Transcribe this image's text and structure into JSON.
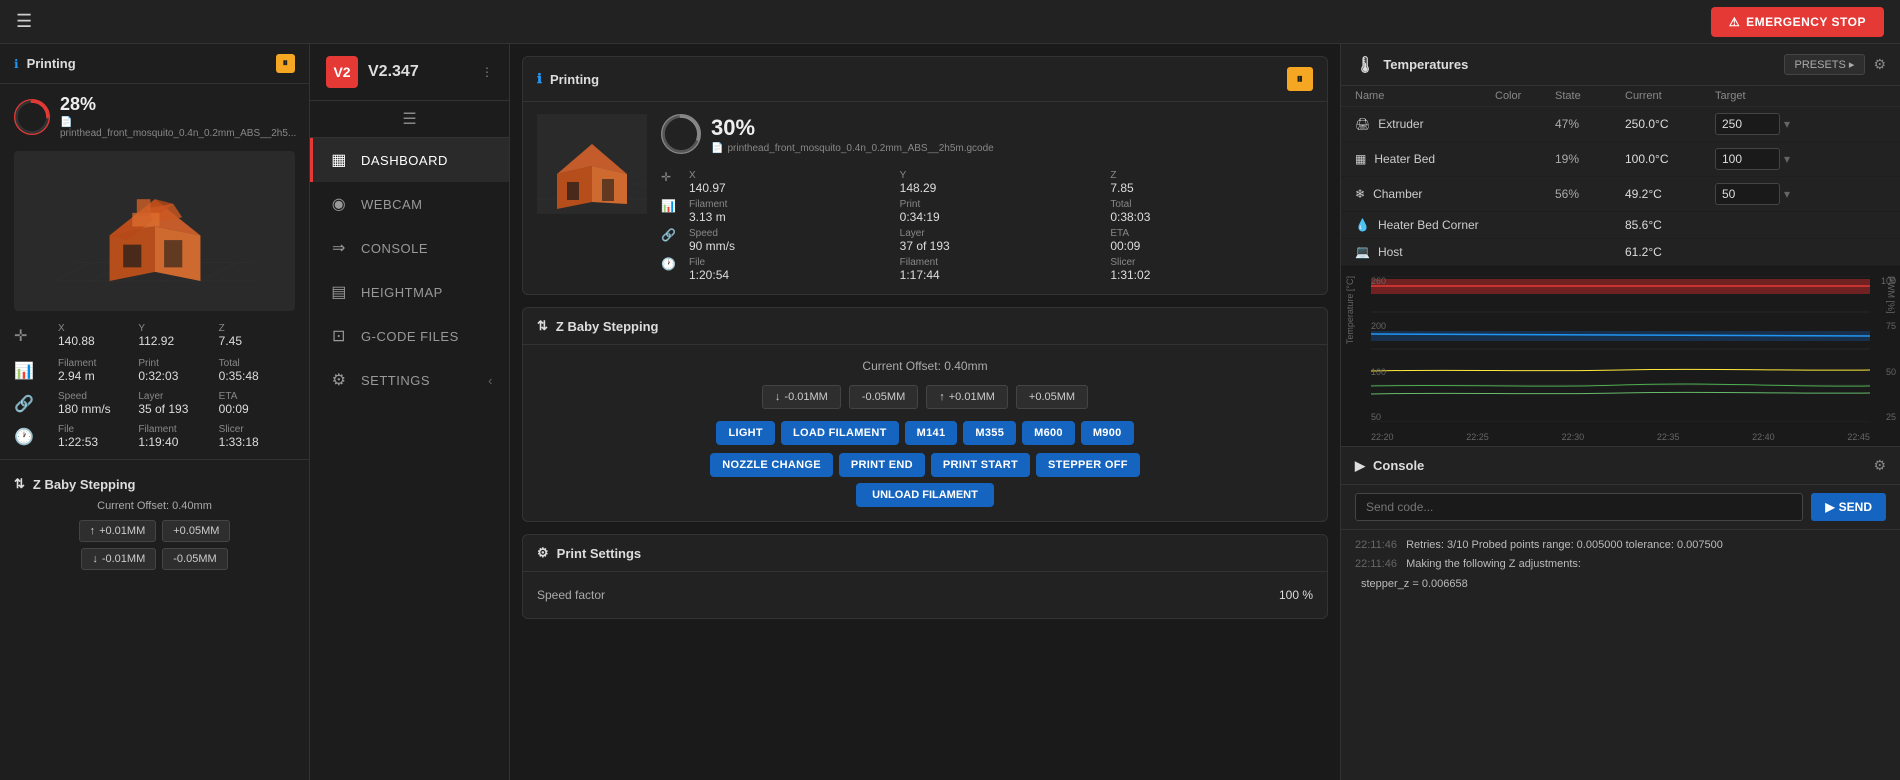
{
  "topbar": {
    "emergency_label": "EMERGENCY STOP",
    "hamburger_icon": "☰"
  },
  "left_panel": {
    "title": "Printing",
    "pause_label": "⏸",
    "progress_percent": "28%",
    "filename": "printhead_front_mosquito_0.4n_0.2mm_ABS__2h5...",
    "stats": {
      "x_label": "X",
      "x_value": "140.88",
      "y_label": "Y",
      "y_value": "112.92",
      "z_label": "Z",
      "z_value": "7.45",
      "filament_label": "Filament",
      "filament_value": "2.94 m",
      "print_label": "Print",
      "print_value": "0:32:03",
      "total_label": "Total",
      "total_value": "0:35:48",
      "speed_label": "Speed",
      "speed_value": "180 mm/s",
      "layer_label": "Layer",
      "layer_value": "35 of 193",
      "eta_label": "ETA",
      "eta_value": "00:09",
      "file_label": "File",
      "file_value": "1:22:53",
      "filament2_label": "Filament",
      "filament2_value": "1:19:40",
      "slicer_label": "Slicer",
      "slicer_value": "1:33:18"
    },
    "baby_stepping": {
      "title": "Z Baby Stepping",
      "offset_label": "Current Offset: 0.40mm",
      "btn_up_01": "+0.01MM",
      "btn_up_05": "+0.05MM",
      "btn_dn_01": "-0.01MM",
      "btn_dn_05": "-0.05MM"
    }
  },
  "nav": {
    "logo": "V2",
    "version": "V2.347",
    "hamburger": "≡",
    "items": [
      {
        "id": "dashboard",
        "label": "DASHBOARD",
        "icon": "▦",
        "active": true
      },
      {
        "id": "webcam",
        "label": "WEBCAM",
        "icon": "◉"
      },
      {
        "id": "console",
        "label": "CONSOLE",
        "icon": "⇒"
      },
      {
        "id": "heightmap",
        "label": "HEIGHTMAP",
        "icon": "▤"
      },
      {
        "id": "gcode-files",
        "label": "G-CODE FILES",
        "icon": "⊡"
      },
      {
        "id": "settings",
        "label": "SETTINGS",
        "icon": "⚙",
        "has_collapse": true
      }
    ]
  },
  "printing_card": {
    "title": "Printing",
    "pause_label": "⏸",
    "progress_percent": "30%",
    "filename": "printhead_front_mosquito_0.4n_0.2mm_ABS__2h5m.gcode",
    "stats": {
      "x_label": "X",
      "x_value": "140.97",
      "y_label": "Y",
      "y_value": "148.29",
      "z_label": "Z",
      "z_value": "7.85",
      "filament_label": "Filament",
      "filament_value": "3.13 m",
      "print_label": "Print",
      "print_value": "0:34:19",
      "total_label": "Total",
      "total_value": "0:38:03",
      "speed_label": "Speed",
      "speed_value": "90 mm/s",
      "layer_label": "Layer",
      "layer_value": "37 of 193",
      "eta_label": "ETA",
      "eta_value": "00:09",
      "file_label": "File",
      "file_value": "1:20:54",
      "filament2_label": "Filament",
      "filament2_value": "1:17:44",
      "slicer_label": "Slicer",
      "slicer_value": "1:31:02"
    }
  },
  "z_baby_card": {
    "title": "Z Baby Stepping",
    "offset": "Current Offset: 0.40mm",
    "btn_dn_01": "-0.01MM",
    "btn_dn_05": "-0.05MM",
    "btn_up_01": "+0.01MM",
    "btn_up_05": "+0.05MM"
  },
  "macros": {
    "row1": [
      "LIGHT",
      "LOAD FILAMENT",
      "M141",
      "M355",
      "M600",
      "M900"
    ],
    "row2": [
      "NOZZLE CHANGE",
      "PRINT END",
      "PRINT START",
      "STEPPER OFF"
    ],
    "row3": [
      "UNLOAD FILAMENT"
    ]
  },
  "print_settings": {
    "title": "Print Settings",
    "speed_factor_label": "Speed factor",
    "speed_factor_value": "100 %"
  },
  "temperatures": {
    "title": "Temperatures",
    "presets_btn": "PRESETS ▸",
    "table_headers": {
      "name": "Name",
      "color": "Color",
      "state": "State",
      "current": "Current",
      "target": "Target"
    },
    "rows": [
      {
        "name": "Extruder",
        "icon": "🖨",
        "color": "#e53935",
        "state": "47%",
        "current": "250.0°C",
        "target": "250"
      },
      {
        "name": "Heater Bed",
        "icon": "▦",
        "color": "#2196f3",
        "state": "19%",
        "current": "100.0°C",
        "target": "100"
      },
      {
        "name": "Chamber",
        "icon": "❄",
        "color": "#4caf50",
        "state": "56%",
        "current": "49.2°C",
        "target": "50"
      },
      {
        "name": "Heater Bed Corner",
        "icon": "💧",
        "color": "#ffeb3b",
        "state": "",
        "current": "85.6°C",
        "target": ""
      },
      {
        "name": "Host",
        "icon": "💻",
        "color": "#4caf50",
        "state": "",
        "current": "61.2°C",
        "target": ""
      }
    ],
    "chart": {
      "y_labels": [
        "260",
        "200",
        "100",
        "50"
      ],
      "y_labels_right": [
        "100",
        "75",
        "50",
        "25"
      ],
      "x_labels": [
        "22:20",
        "22:25",
        "22:30",
        "22:35",
        "22:40",
        "22:45"
      ],
      "y_axis_label": "Temperature [°C]",
      "y_axis_right_label": "PWM [%]"
    }
  },
  "console": {
    "title": "Console",
    "send_code_placeholder": "Send code...",
    "send_btn": "SEND",
    "logs": [
      {
        "time": "22:11:46",
        "text": "Retries: 3/10 Probed points range: 0.005000 tolerance: 0.007500"
      },
      {
        "time": "22:11:46",
        "text": "Making the following Z adjustments:"
      },
      {
        "time": "",
        "text": "stepper_z = 0.006658"
      }
    ]
  }
}
